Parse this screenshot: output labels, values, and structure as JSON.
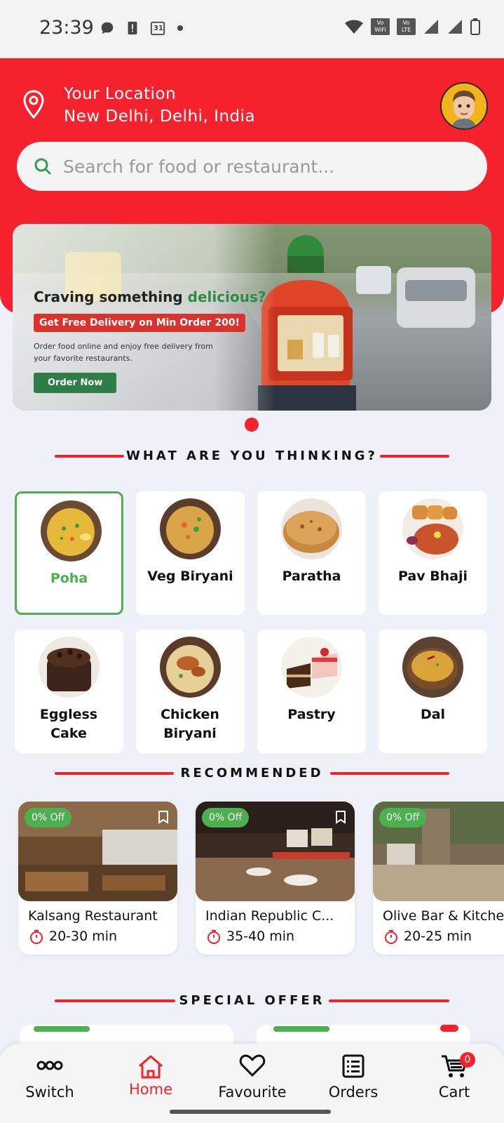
{
  "status_bar": {
    "time": "23:39",
    "left_icons": [
      "chat-bubble-icon",
      "alert-icon",
      "calendar-icon",
      "dot-icon"
    ],
    "calendar_day": "31",
    "right_icons": [
      "wifi-icon",
      "vowifi-icon",
      "volte-icon",
      "signal-icon",
      "signal-icon",
      "battery-icon"
    ],
    "vowifi_label": "Vo WiFi",
    "volte_label": "Vo LTE"
  },
  "header": {
    "location_label": "Your Location",
    "location_value": "New Delhi, Delhi, India",
    "search_placeholder": "Search for food or restaurant...",
    "accent": "#f5222d"
  },
  "banner": {
    "title_part1": "Craving something ",
    "title_part2": "delicious?",
    "badge": "Get Free Delivery on Min Order 200!",
    "description": "Order food online and enjoy free delivery from your favorite restaurants.",
    "button": "Order Now"
  },
  "sections": {
    "thinking": "WHAT ARE YOU THINKING?",
    "recommended": "RECOMMENDED",
    "special_offer": "SPECIAL OFFER"
  },
  "categories": [
    {
      "label": "Poha",
      "selected": true
    },
    {
      "label": "Veg Biryani"
    },
    {
      "label": "Paratha"
    },
    {
      "label": "Pav Bhaji"
    },
    {
      "label": "Eggless Cake"
    },
    {
      "label": "Chicken Biryani"
    },
    {
      "label": "Pastry"
    },
    {
      "label": "Dal"
    }
  ],
  "restaurants": [
    {
      "name": "Kalsang Restaurant",
      "time": "20-30 min",
      "offer": "0% Off"
    },
    {
      "name": "Indian Republic C...",
      "time": "35-40 min",
      "offer": "0% Off"
    },
    {
      "name": "Olive Bar & Kitchen",
      "time": "20-25 min",
      "offer": "0% Off"
    }
  ],
  "bottom_nav": {
    "switch": "Switch",
    "home": "Home",
    "favourite": "Favourite",
    "orders": "Orders",
    "cart": "Cart",
    "cart_count": "0",
    "active": "home"
  }
}
